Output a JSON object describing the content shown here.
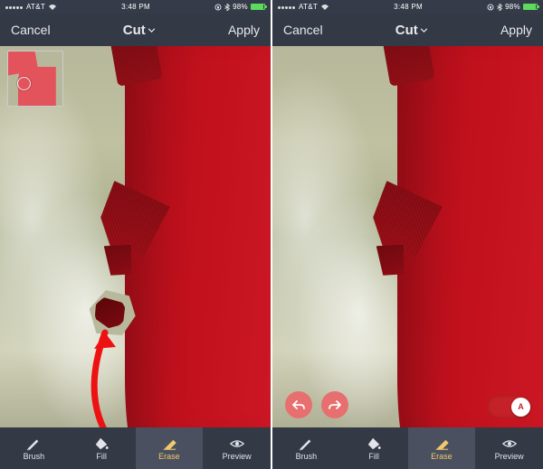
{
  "status": {
    "carrier": "AT&T",
    "time": "3:48 PM",
    "bt_pct": "98%"
  },
  "nav": {
    "cancel": "Cancel",
    "title": "Cut",
    "apply": "Apply"
  },
  "toolbar": {
    "brush": "Brush",
    "fill": "Fill",
    "erase": "Erase",
    "preview": "Preview"
  },
  "undoRedo": {
    "undo_icon": "↶",
    "redo_icon": "↷"
  },
  "toggle": {
    "auto_label": "A"
  }
}
